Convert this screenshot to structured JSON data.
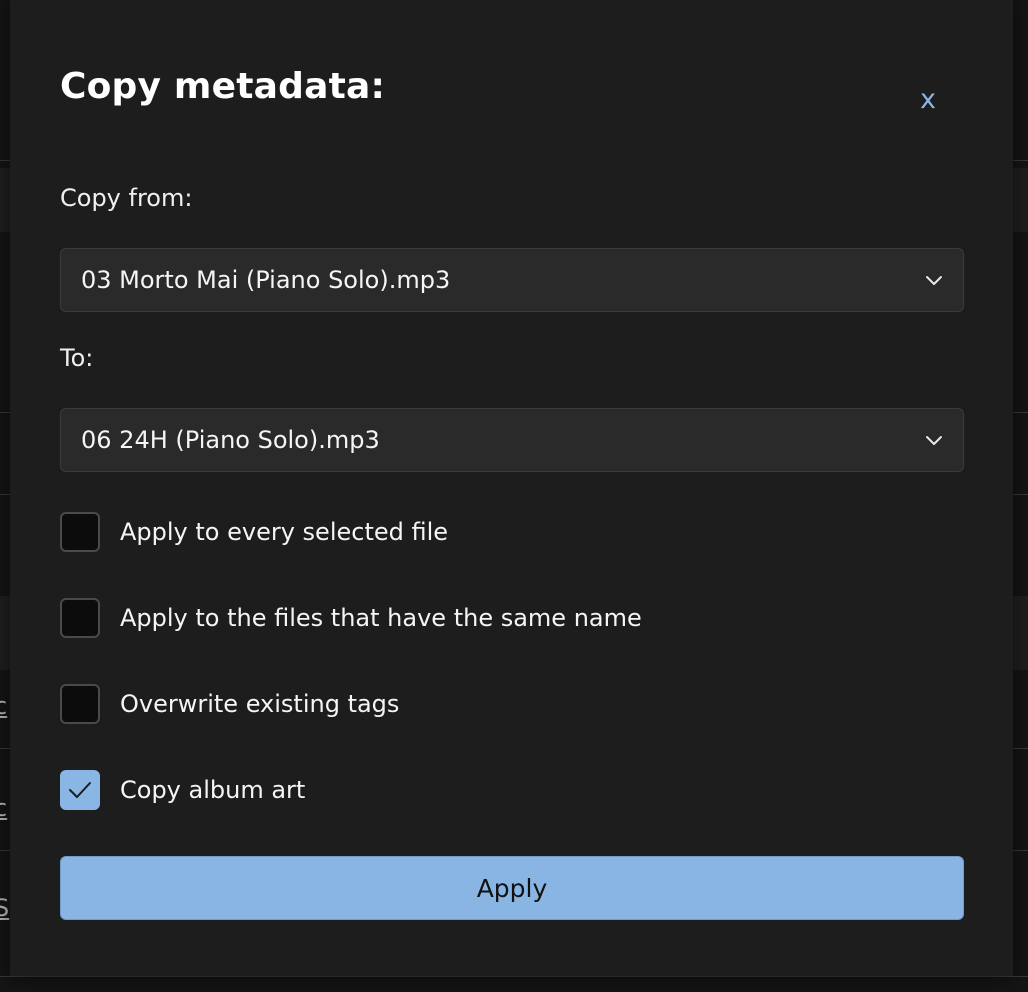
{
  "background": {
    "fragments": [
      "c",
      "c",
      "S"
    ]
  },
  "dialog": {
    "title": "Copy metadata:",
    "close_label": "x",
    "copy_from_label": "Copy from:",
    "copy_from_value": "03 Morto Mai (Piano Solo).mp3",
    "to_label": "To:",
    "to_value": "06 24H (Piano Solo).mp3",
    "options": [
      {
        "label": "Apply to every selected file",
        "checked": false
      },
      {
        "label": "Apply to the files that have the same name",
        "checked": false
      },
      {
        "label": "Overwrite existing tags",
        "checked": false
      },
      {
        "label": "Copy album art",
        "checked": true
      }
    ],
    "apply_label": "Apply"
  },
  "colors": {
    "accent": "#89b5e5",
    "dialog_bg": "#1d1d1d",
    "field_bg": "#2a2a2a"
  },
  "icons": {
    "close": "close-icon",
    "dropdown": "chevron-down-icon",
    "check": "checkmark-icon"
  }
}
